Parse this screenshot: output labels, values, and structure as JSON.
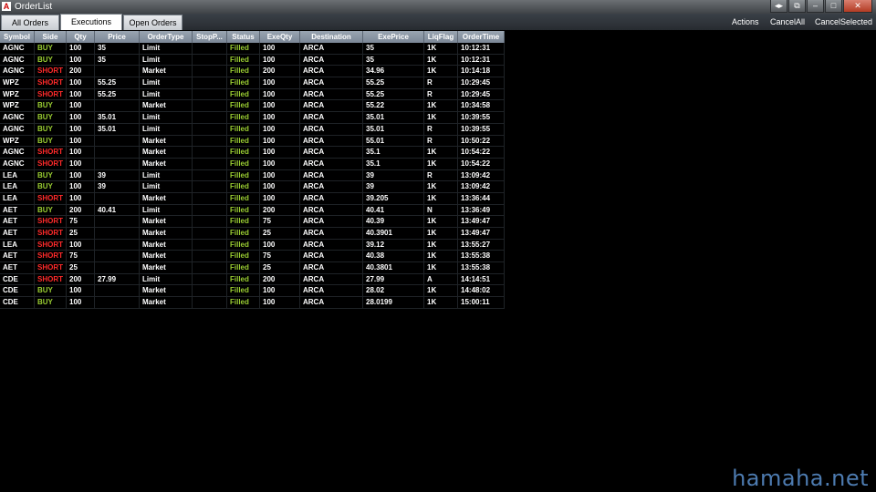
{
  "window": {
    "title": "OrderList",
    "icon_letter": "A"
  },
  "window_controls": {
    "prev": "◂▸",
    "restore": "⧉",
    "minimize": "–",
    "maximize": "□",
    "close": "✕"
  },
  "tabs": [
    {
      "label": "All Orders",
      "active": false
    },
    {
      "label": "Executions",
      "active": true
    },
    {
      "label": "Open Orders",
      "active": false
    }
  ],
  "actions": {
    "actions": "Actions",
    "cancel_all": "CancelAll",
    "cancel_selected": "CancelSelected"
  },
  "columns": [
    "Symbol",
    "Side",
    "Qty",
    "Price",
    "OrderType",
    "StopP...",
    "Status",
    "ExeQty",
    "Destination",
    "ExePrice",
    "LiqFlag",
    "OrderTime"
  ],
  "rows": [
    [
      "AGNC",
      "BUY",
      "100",
      "35",
      "Limit",
      "",
      "Filled",
      "100",
      "ARCA",
      "35",
      "1K",
      "10:12:31"
    ],
    [
      "AGNC",
      "BUY",
      "100",
      "35",
      "Limit",
      "",
      "Filled",
      "100",
      "ARCA",
      "35",
      "1K",
      "10:12:31"
    ],
    [
      "AGNC",
      "SHORT",
      "200",
      "",
      "Market",
      "",
      "Filled",
      "200",
      "ARCA",
      "34.96",
      "1K",
      "10:14:18"
    ],
    [
      "WPZ",
      "SHORT",
      "100",
      "55.25",
      "Limit",
      "",
      "Filled",
      "100",
      "ARCA",
      "55.25",
      "R",
      "10:29:45"
    ],
    [
      "WPZ",
      "SHORT",
      "100",
      "55.25",
      "Limit",
      "",
      "Filled",
      "100",
      "ARCA",
      "55.25",
      "R",
      "10:29:45"
    ],
    [
      "WPZ",
      "BUY",
      "100",
      "",
      "Market",
      "",
      "Filled",
      "100",
      "ARCA",
      "55.22",
      "1K",
      "10:34:58"
    ],
    [
      "AGNC",
      "BUY",
      "100",
      "35.01",
      "Limit",
      "",
      "Filled",
      "100",
      "ARCA",
      "35.01",
      "1K",
      "10:39:55"
    ],
    [
      "AGNC",
      "BUY",
      "100",
      "35.01",
      "Limit",
      "",
      "Filled",
      "100",
      "ARCA",
      "35.01",
      "R",
      "10:39:55"
    ],
    [
      "WPZ",
      "BUY",
      "100",
      "",
      "Market",
      "",
      "Filled",
      "100",
      "ARCA",
      "55.01",
      "R",
      "10:50:22"
    ],
    [
      "AGNC",
      "SHORT",
      "100",
      "",
      "Market",
      "",
      "Filled",
      "100",
      "ARCA",
      "35.1",
      "1K",
      "10:54:22"
    ],
    [
      "AGNC",
      "SHORT",
      "100",
      "",
      "Market",
      "",
      "Filled",
      "100",
      "ARCA",
      "35.1",
      "1K",
      "10:54:22"
    ],
    [
      "LEA",
      "BUY",
      "100",
      "39",
      "Limit",
      "",
      "Filled",
      "100",
      "ARCA",
      "39",
      "R",
      "13:09:42"
    ],
    [
      "LEA",
      "BUY",
      "100",
      "39",
      "Limit",
      "",
      "Filled",
      "100",
      "ARCA",
      "39",
      "1K",
      "13:09:42"
    ],
    [
      "LEA",
      "SHORT",
      "100",
      "",
      "Market",
      "",
      "Filled",
      "100",
      "ARCA",
      "39.205",
      "1K",
      "13:36:44"
    ],
    [
      "AET",
      "BUY",
      "200",
      "40.41",
      "Limit",
      "",
      "Filled",
      "200",
      "ARCA",
      "40.41",
      "N",
      "13:36:49"
    ],
    [
      "AET",
      "SHORT",
      "75",
      "",
      "Market",
      "",
      "Filled",
      "75",
      "ARCA",
      "40.39",
      "1K",
      "13:49:47"
    ],
    [
      "AET",
      "SHORT",
      "25",
      "",
      "Market",
      "",
      "Filled",
      "25",
      "ARCA",
      "40.3901",
      "1K",
      "13:49:47"
    ],
    [
      "LEA",
      "SHORT",
      "100",
      "",
      "Market",
      "",
      "Filled",
      "100",
      "ARCA",
      "39.12",
      "1K",
      "13:55:27"
    ],
    [
      "AET",
      "SHORT",
      "75",
      "",
      "Market",
      "",
      "Filled",
      "75",
      "ARCA",
      "40.38",
      "1K",
      "13:55:38"
    ],
    [
      "AET",
      "SHORT",
      "25",
      "",
      "Market",
      "",
      "Filled",
      "25",
      "ARCA",
      "40.3801",
      "1K",
      "13:55:38"
    ],
    [
      "CDE",
      "SHORT",
      "200",
      "27.99",
      "Limit",
      "",
      "Filled",
      "200",
      "ARCA",
      "27.99",
      "A",
      "14:14:51"
    ],
    [
      "CDE",
      "BUY",
      "100",
      "",
      "Market",
      "",
      "Filled",
      "100",
      "ARCA",
      "28.02",
      "1K",
      "14:48:02"
    ],
    [
      "CDE",
      "BUY",
      "100",
      "",
      "Market",
      "",
      "Filled",
      "100",
      "ARCA",
      "28.0199",
      "1K",
      "15:00:11"
    ]
  ],
  "colors": {
    "buy": "#9acd32",
    "short": "#ff2a2a",
    "filled": "#9acd32",
    "background": "#000000",
    "header": "#8a96a4"
  },
  "watermark": "hamaha.net"
}
